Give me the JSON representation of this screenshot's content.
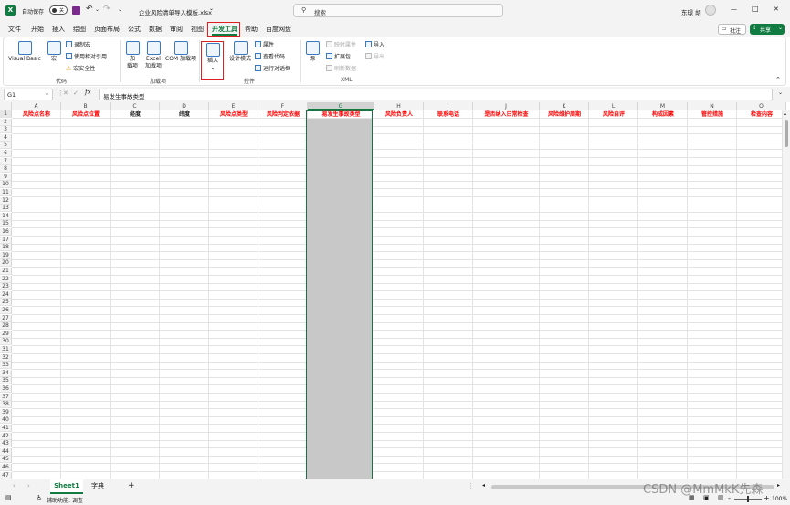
{
  "title": {
    "autosave_label": "自动保存",
    "autosave_state": "关",
    "filename": "企业风险清单导入模板.xlsx",
    "filename_arrow": "⌄",
    "search_placeholder": "搜索",
    "user": "东璟 胡",
    "minimize": "—",
    "maximize": "□",
    "close": "✕"
  },
  "menu": {
    "items": [
      "文件",
      "开始",
      "插入",
      "绘图",
      "页面布局",
      "公式",
      "数据",
      "审阅",
      "视图",
      "开发工具",
      "帮助",
      "百度网盘"
    ],
    "active_index": 9,
    "comment_button": "批注",
    "share_button": "共享"
  },
  "ribbon": {
    "visual_basic": "Visual Basic",
    "macros": "宏",
    "record_macro": "录制宏",
    "relative_refs": "使用相对引用",
    "macro_security": "宏安全性",
    "group_code": "代码",
    "addins": "加\n载项",
    "excel_addins": "Excel\n加载项",
    "com_addins": "COM 加载项",
    "group_addins": "加载项",
    "insert": "插入",
    "insert_arrow": "⌄",
    "design_mode": "设计模式",
    "properties": "属性",
    "view_code": "查看代码",
    "run_dialog": "运行对话框",
    "group_controls": "控件",
    "source": "源",
    "map_properties": "映射属性",
    "expansion_packs": "扩展包",
    "refresh_data": "刷新数据",
    "import": "导入",
    "export": "导出",
    "group_xml": "XML"
  },
  "formula_bar": {
    "name_box": "G1",
    "fx": "fx",
    "cancel": "✕",
    "enter": "✓",
    "content": "易发生事故类型"
  },
  "sheet": {
    "columns": [
      "A",
      "B",
      "C",
      "D",
      "E",
      "F",
      "G",
      "H",
      "I",
      "J",
      "K",
      "L",
      "M",
      "N",
      "O"
    ],
    "headers": [
      "风险点名称",
      "风险点位置",
      "经度",
      "纬度",
      "风险点类型",
      "风险判定依据",
      "易发生事故类型",
      "风险负责人",
      "联系电话",
      "是否纳入日常检查",
      "风险维护周期",
      "风险自评",
      "构成因素",
      "管控措施",
      "检查内容"
    ],
    "header_colors": [
      "#ff0000",
      "#ff0000",
      "#222222",
      "#222222",
      "#ff0000",
      "#ff0000",
      "#ff0000",
      "#ff0000",
      "#ff0000",
      "#ff0000",
      "#ff0000",
      "#ff0000",
      "#ff0000",
      "#ff0000",
      "#ff0000"
    ],
    "row_count": 47,
    "selected_column": "G"
  },
  "tabs": {
    "items": [
      "Sheet1",
      "字典"
    ],
    "active": "Sheet1",
    "add": "+"
  },
  "status": {
    "ready_icon": "cell-mode-icon",
    "accessibility": "辅助功能: 调查",
    "zoom": "100%",
    "zoom_minus": "-",
    "zoom_plus": "+"
  },
  "watermark": "CSDN @MmMkK先森",
  "colors": {
    "excel_green": "#107c41",
    "highlight_red": "#e02020",
    "selection_gray": "#c8c8c8",
    "selection_border": "#1e7145"
  }
}
